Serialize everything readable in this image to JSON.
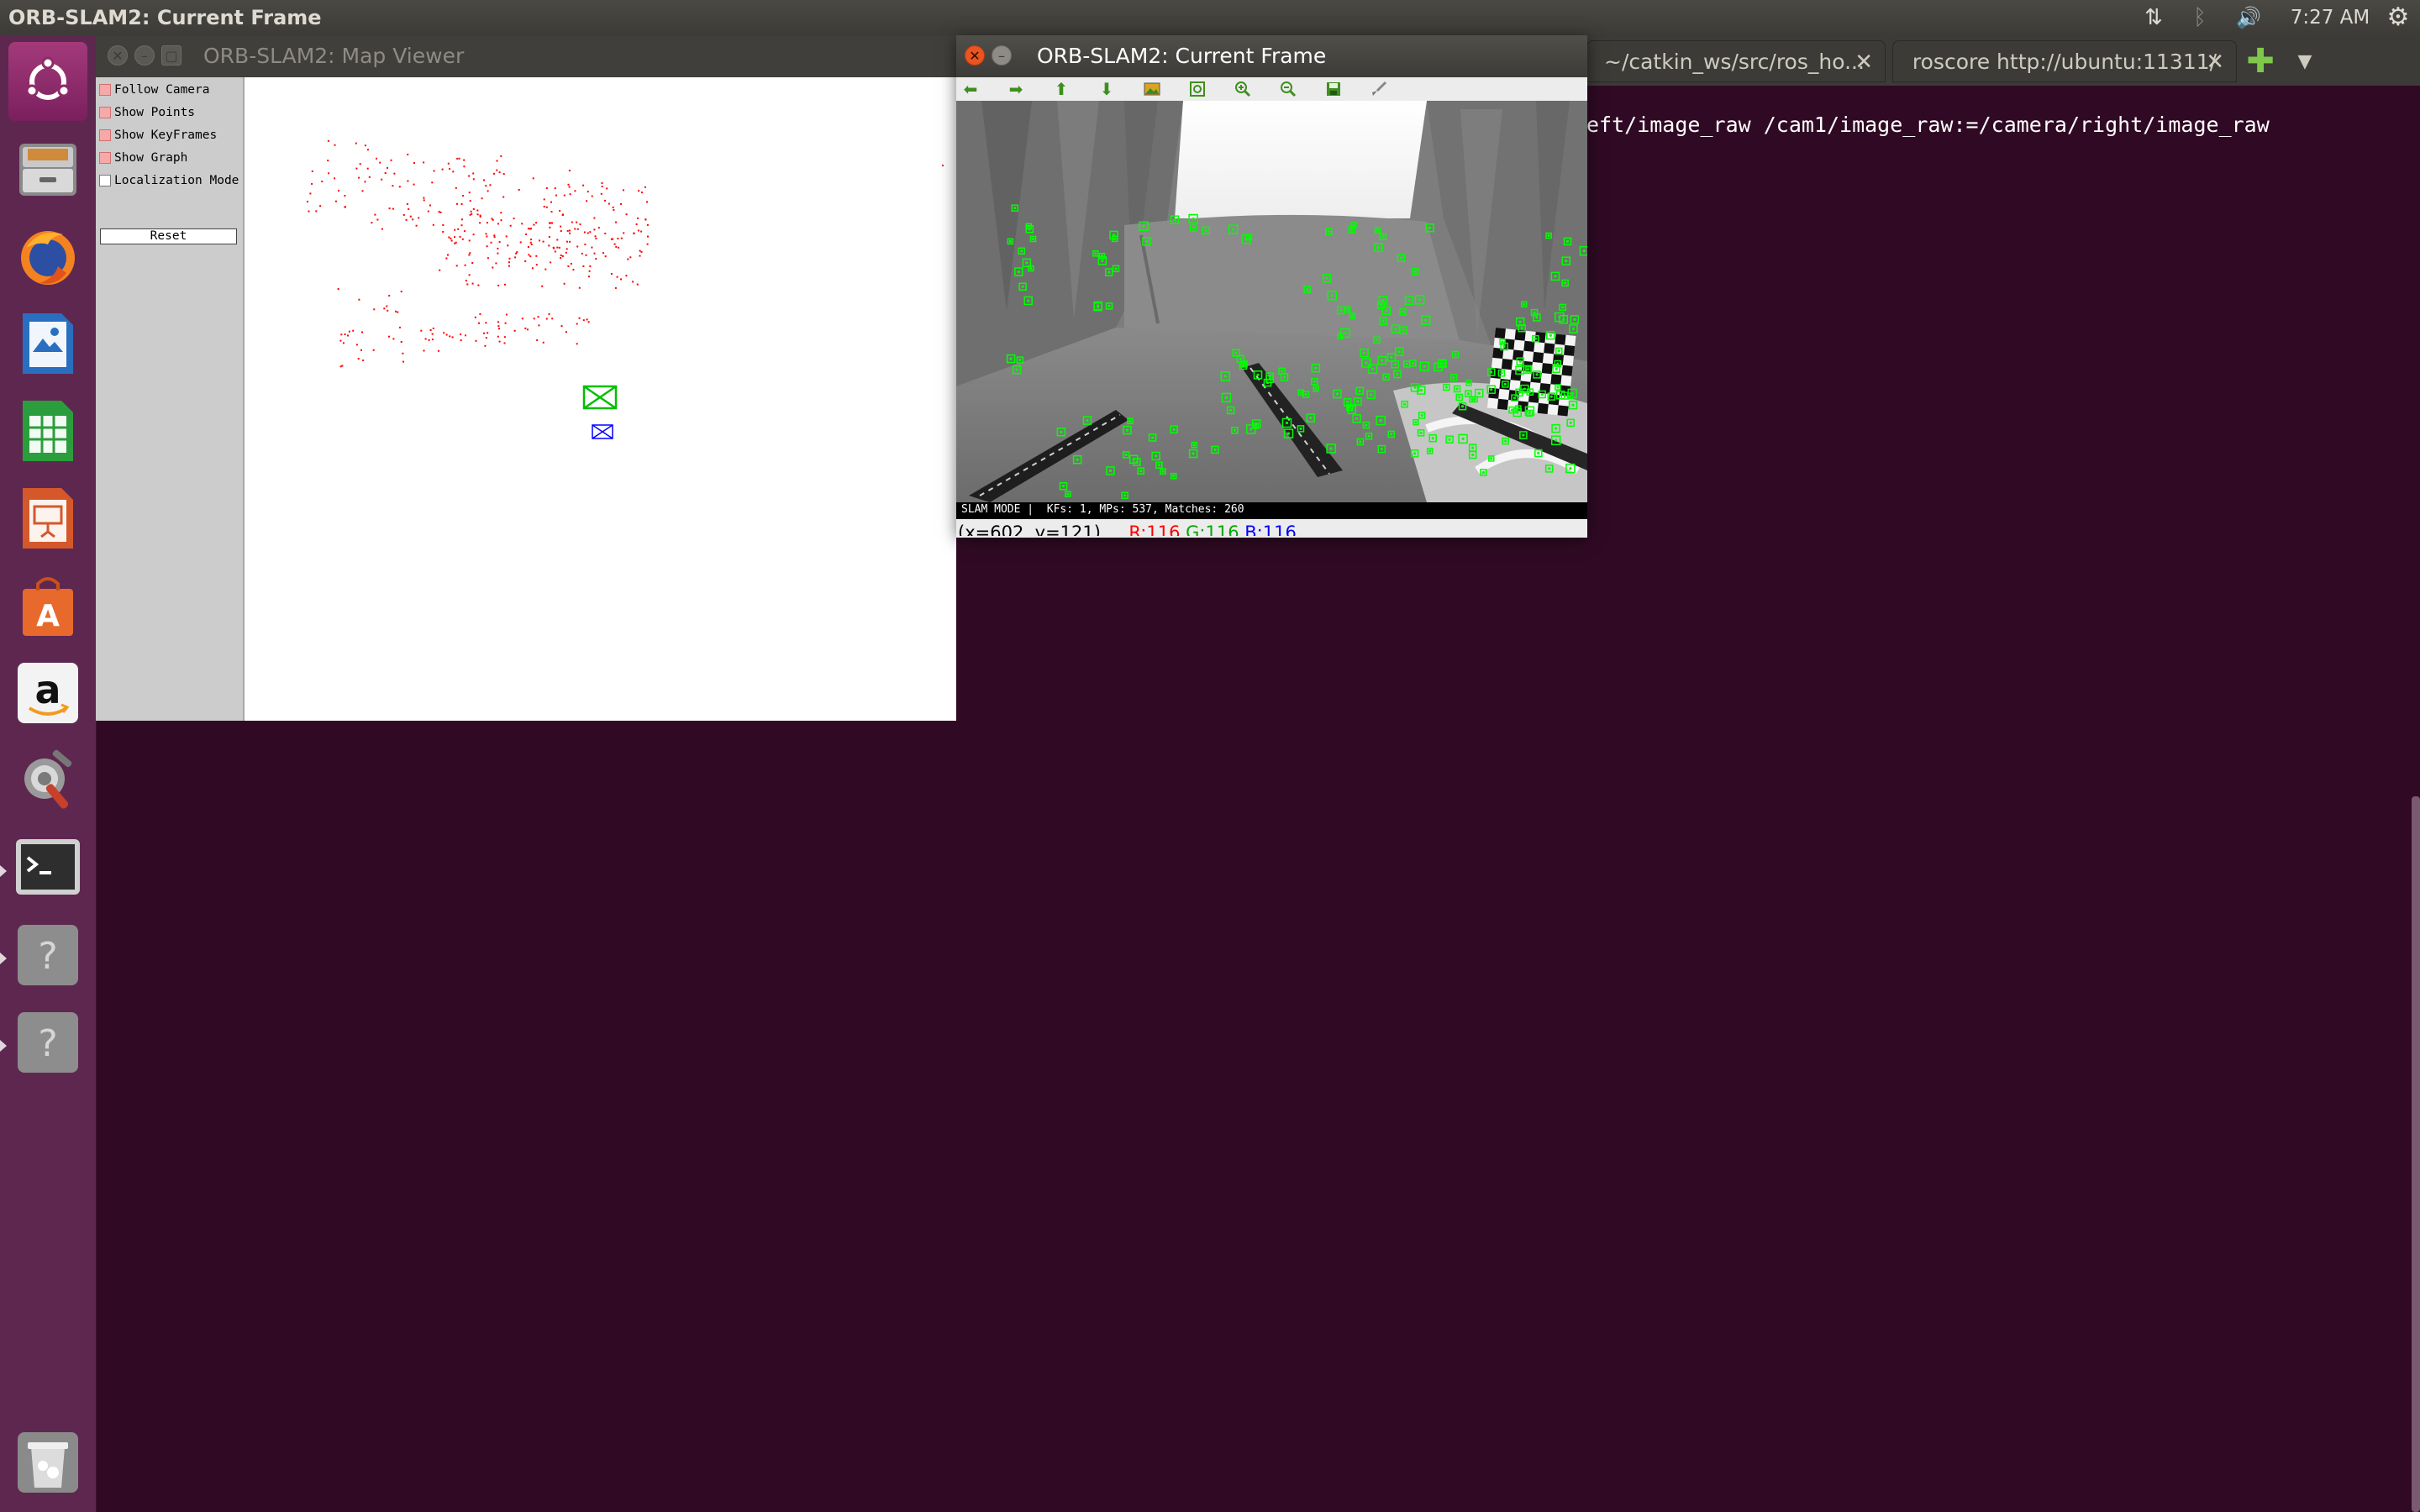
{
  "top_panel": {
    "title": "ORB-SLAM2: Current Frame",
    "clock": "7:27 AM"
  },
  "launcher": {
    "items": [
      {
        "name": "ubuntu-dash",
        "icon": "ubuntu-logo-icon"
      },
      {
        "name": "files",
        "icon": "file-cabinet-icon"
      },
      {
        "name": "firefox",
        "icon": "firefox-icon"
      },
      {
        "name": "writer",
        "icon": "libreoffice-writer-icon"
      },
      {
        "name": "calc",
        "icon": "libreoffice-calc-icon"
      },
      {
        "name": "impress",
        "icon": "libreoffice-impress-icon"
      },
      {
        "name": "software-center",
        "icon": "shopping-bag-icon"
      },
      {
        "name": "amazon",
        "icon": "amazon-icon"
      },
      {
        "name": "system-settings",
        "icon": "settings-icon"
      },
      {
        "name": "terminal",
        "icon": "terminal-icon"
      },
      {
        "name": "unknown-app-1",
        "icon": "question-mark-icon"
      },
      {
        "name": "unknown-app-2",
        "icon": "question-mark-icon"
      },
      {
        "name": "trash",
        "icon": "trash-icon"
      }
    ]
  },
  "terminal": {
    "tabs": [
      {
        "label": "~/catkin_ws/src/ros_ho..."
      },
      {
        "label": "roscore http://ubuntu:11311/"
      }
    ],
    "line": "eft/image_raw /cam1/image_raw:=/camera/right/image_raw"
  },
  "map_viewer": {
    "title": "ORB-SLAM2: Map Viewer",
    "options": [
      {
        "label": "Follow Camera",
        "checked": true
      },
      {
        "label": "Show Points",
        "checked": true
      },
      {
        "label": "Show KeyFrames",
        "checked": true
      },
      {
        "label": "Show Graph",
        "checked": true
      },
      {
        "label": "Localization Mode",
        "checked": false
      }
    ],
    "reset_label": "Reset",
    "colors": {
      "map_points": "#ff0000",
      "current_camera": "#00c000",
      "keyframe": "#0000ff"
    }
  },
  "current_frame": {
    "title": "ORB-SLAM2: Current Frame",
    "toolbar": [
      "arrow-left-icon",
      "arrow-right-icon",
      "arrow-up-icon",
      "arrow-down-icon",
      "image-icon",
      "zoom-fit-icon",
      "zoom-in-icon",
      "zoom-out-icon",
      "save-icon",
      "brush-icon"
    ],
    "status": "SLAM MODE |  KFs: 1, MPs: 537, Matches: 260",
    "coord": "(x=602, y=121)",
    "r": "R:116",
    "g": "G:116",
    "b": "B:116",
    "colors": {
      "feature": "#00ff00",
      "r": "#ff0000",
      "g": "#00aa00",
      "b": "#0000ff"
    }
  }
}
